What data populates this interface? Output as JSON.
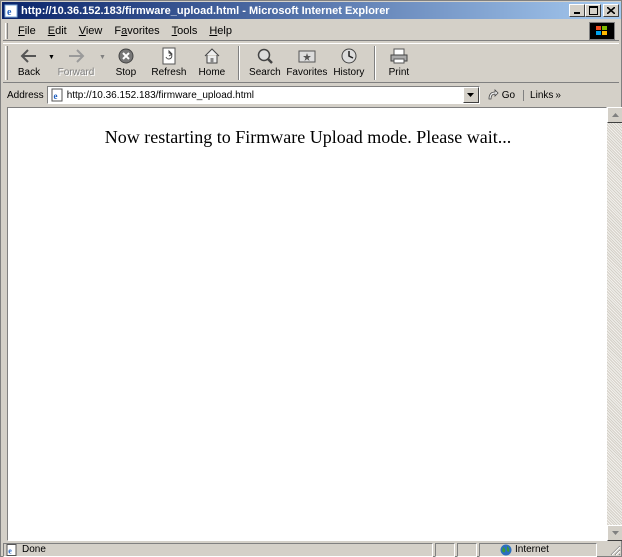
{
  "window": {
    "title": "http://10.36.152.183/firmware_upload.html - Microsoft Internet Explorer"
  },
  "menu": [
    {
      "label": "File",
      "key": "F"
    },
    {
      "label": "Edit",
      "key": "E"
    },
    {
      "label": "View",
      "key": "V"
    },
    {
      "label": "Favorites",
      "key": "a"
    },
    {
      "label": "Tools",
      "key": "T"
    },
    {
      "label": "Help",
      "key": "H"
    }
  ],
  "toolbar": {
    "back": "Back",
    "forward": "Forward",
    "stop": "Stop",
    "refresh": "Refresh",
    "home": "Home",
    "search": "Search",
    "favorites": "Favorites",
    "history": "History",
    "print": "Print"
  },
  "address": {
    "label": "Address",
    "url": "http://10.36.152.183/firmware_upload.html",
    "go": "Go",
    "links": "Links"
  },
  "page": {
    "message": "Now restarting to Firmware Upload mode. Please wait..."
  },
  "status": {
    "text": "Done",
    "zone": "Internet"
  },
  "colors": {
    "titlebar_start": "#0a246a",
    "titlebar_end": "#a6caf0",
    "chrome": "#d4d0c8"
  }
}
